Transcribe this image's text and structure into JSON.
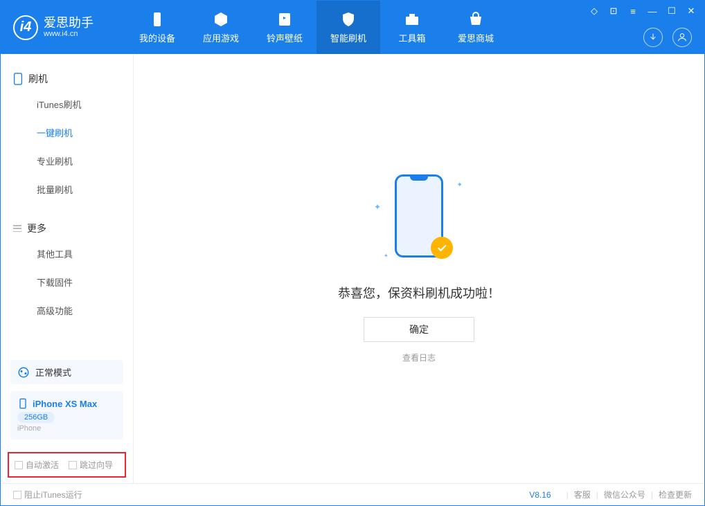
{
  "app": {
    "title": "爱思助手",
    "subtitle": "www.i4.cn"
  },
  "tabs": [
    "我的设备",
    "应用游戏",
    "铃声壁纸",
    "智能刷机",
    "工具箱",
    "爱思商城"
  ],
  "sidebar": {
    "group1_title": "刷机",
    "items1": [
      "iTunes刷机",
      "一键刷机",
      "专业刷机",
      "批量刷机"
    ],
    "group2_title": "更多",
    "items2": [
      "其他工具",
      "下载固件",
      "高级功能"
    ]
  },
  "device": {
    "mode": "正常模式",
    "name": "iPhone XS Max",
    "storage": "256GB",
    "type": "iPhone"
  },
  "checks": {
    "auto_activate": "自动激活",
    "skip_guide": "跳过向导"
  },
  "main": {
    "success": "恭喜您，保资料刷机成功啦！",
    "ok": "确定",
    "log": "查看日志"
  },
  "footer": {
    "block_itunes": "阻止iTunes运行",
    "version": "V8.16",
    "links": [
      "客服",
      "微信公众号",
      "检查更新"
    ]
  }
}
